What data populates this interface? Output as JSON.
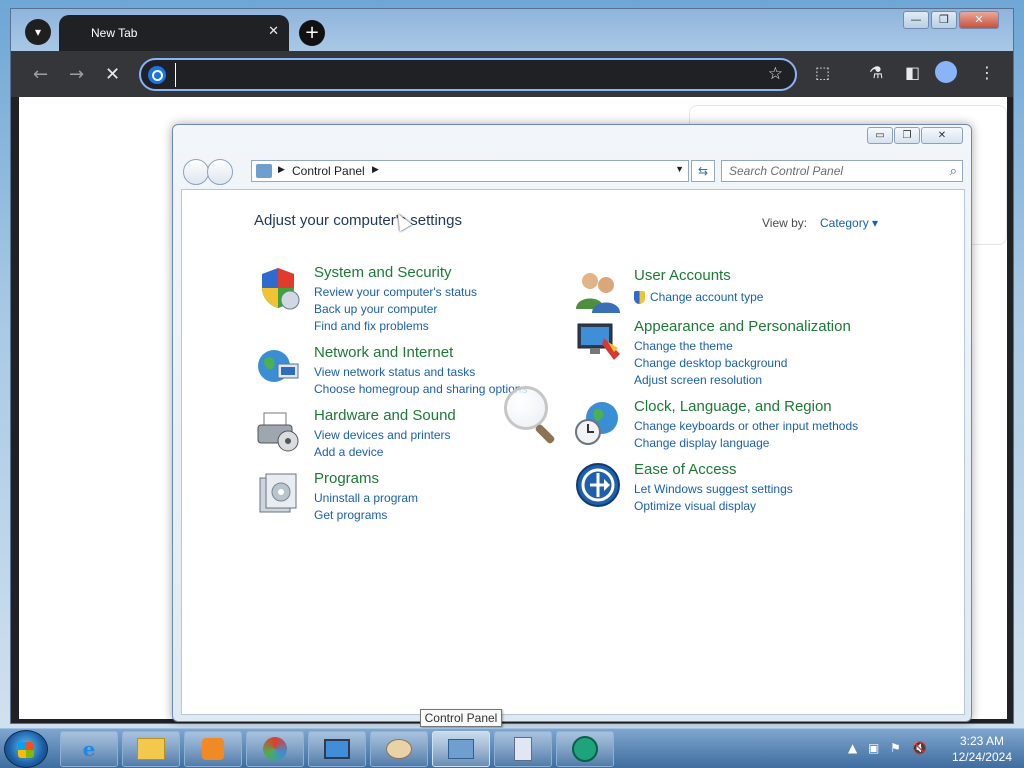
{
  "browser": {
    "tab_title": "New Tab",
    "tab_close": "✕",
    "new_tab": "+",
    "omnibox_value": "",
    "window_controls": [
      "—",
      "❐",
      "✕"
    ]
  },
  "control_panel": {
    "address_location": "Control Panel",
    "search_placeholder": "Search Control Panel",
    "heading": "Adjust your computer's settings",
    "view_by_label": "View by:",
    "view_by_value": "Category ▾",
    "window_controls": [
      "▭",
      "❐",
      "✕"
    ],
    "categories_left": [
      {
        "title": "System and Security",
        "icon": "shield-icon",
        "links": [
          "Review your computer's status",
          "Back up your computer",
          "Find and fix problems"
        ]
      },
      {
        "title": "Network and Internet",
        "icon": "globe-network-icon",
        "links": [
          "View network status and tasks",
          "Choose homegroup and sharing options"
        ]
      },
      {
        "title": "Hardware and Sound",
        "icon": "printer-icon",
        "links": [
          "View devices and printers",
          "Add a device"
        ]
      },
      {
        "title": "Programs",
        "icon": "programs-icon",
        "links": [
          "Uninstall a program",
          "Get programs"
        ]
      }
    ],
    "categories_right": [
      {
        "title": "User Accounts",
        "icon": "users-icon",
        "links": [
          "Change account type"
        ]
      },
      {
        "title": "Appearance and Personalization",
        "icon": "monitor-paint-icon",
        "links": [
          "Change the theme",
          "Change desktop background",
          "Adjust screen resolution"
        ]
      },
      {
        "title": "Clock, Language, and Region",
        "icon": "clock-globe-icon",
        "links": [
          "Change keyboards or other input methods",
          "Change display language"
        ]
      },
      {
        "title": "Ease of Access",
        "icon": "ease-of-access-icon",
        "links": [
          "Let Windows suggest settings",
          "Optimize visual display"
        ]
      }
    ]
  },
  "tooltip": "Control Panel",
  "taskbar": {
    "items": [
      "internet-explorer-icon",
      "folder-icon",
      "media-player-icon",
      "paint-tool-icon",
      "computer-icon",
      "paint-palette-icon",
      "control-panel-icon",
      "calculator-icon",
      "app-circle-icon"
    ],
    "time": "3:23 AM",
    "date": "12/24/2024"
  },
  "colors": {
    "category_title": "#1c7a35",
    "link": "#1a5fb4",
    "omnibox_focus": "#8ab4f8"
  }
}
